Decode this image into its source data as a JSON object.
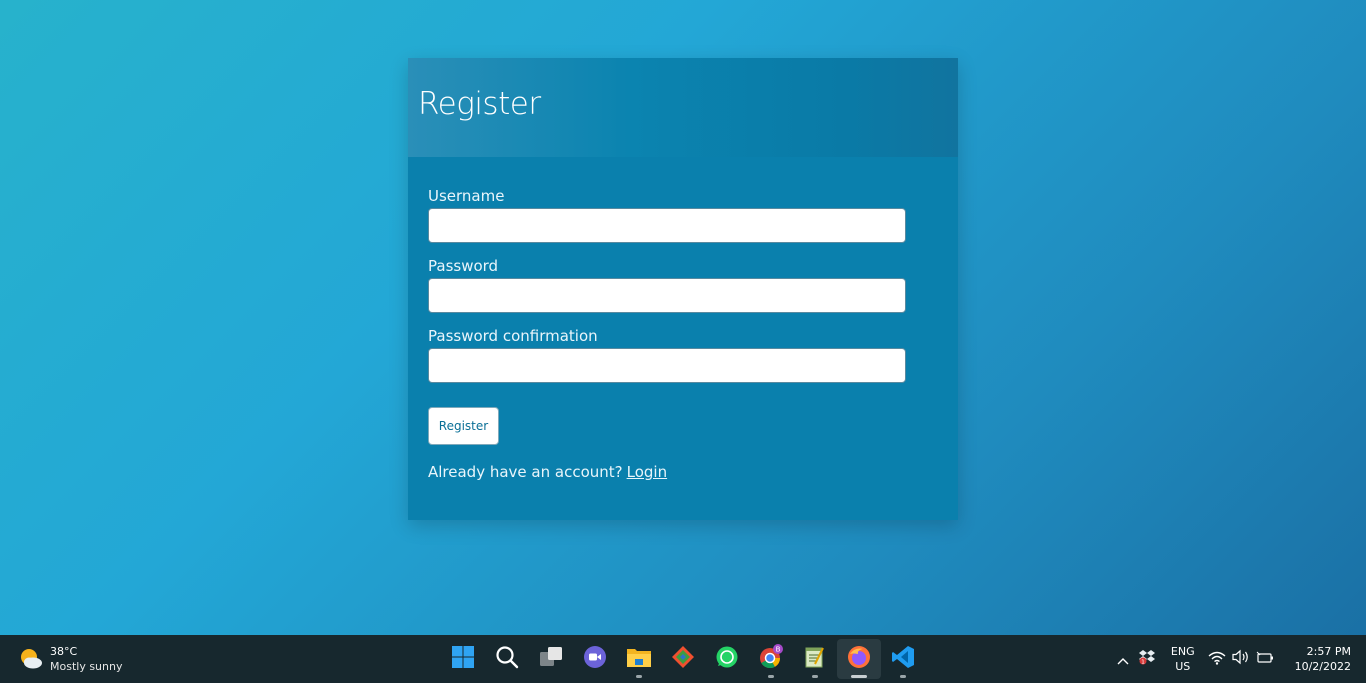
{
  "form": {
    "title": "Register",
    "username_label": "Username",
    "username_value": "",
    "password_label": "Password",
    "password_value": "",
    "password_confirmation_label": "Password confirmation",
    "password_confirmation_value": "",
    "submit_label": "Register",
    "account_prompt": "Already have an account?",
    "login_link": "Login"
  },
  "taskbar": {
    "weather": {
      "temperature": "38°C",
      "description": "Mostly sunny",
      "icon": "partly-sunny-icon"
    },
    "apps": [
      {
        "name": "start-button",
        "icon": "windows-logo-icon"
      },
      {
        "name": "search-button",
        "icon": "search-icon"
      },
      {
        "name": "task-view-button",
        "icon": "task-view-icon"
      },
      {
        "name": "chat-app",
        "icon": "video-chat-icon"
      },
      {
        "name": "file-explorer-app",
        "icon": "folder-icon"
      },
      {
        "name": "git-app",
        "icon": "git-icon"
      },
      {
        "name": "whatsapp-app",
        "icon": "whatsapp-icon"
      },
      {
        "name": "chrome-app",
        "icon": "chrome-icon",
        "badge": "B"
      },
      {
        "name": "notepad-app",
        "icon": "notepad-icon"
      },
      {
        "name": "firefox-app",
        "icon": "firefox-icon",
        "active": true
      },
      {
        "name": "vscode-app",
        "icon": "vscode-icon"
      }
    ],
    "tray": {
      "language_top": "ENG",
      "language_bottom": "US",
      "time": "2:57 PM",
      "date": "10/2/2022",
      "notification_count": "1"
    }
  },
  "colors": {
    "card_background": "#0a80ad",
    "taskbar_background": "#17282e",
    "accent": "#0a6f96"
  }
}
